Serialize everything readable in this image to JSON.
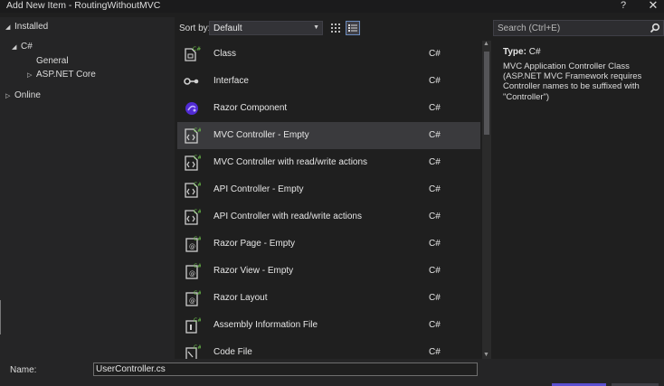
{
  "window": {
    "title": "Add New Item - RoutingWithoutMVC",
    "help": "?",
    "close": "✕"
  },
  "tree": {
    "installed": "Installed",
    "csharp": "C#",
    "general": "General",
    "aspnet": "ASP.NET Core",
    "online": "Online"
  },
  "toolbar": {
    "sort_label": "Sort by:",
    "sort_value": "Default"
  },
  "search": {
    "placeholder": "Search (Ctrl+E)"
  },
  "templates": [
    {
      "name": "Class",
      "lang": "C#",
      "icon": "class-icon"
    },
    {
      "name": "Interface",
      "lang": "C#",
      "icon": "interface-icon"
    },
    {
      "name": "Razor Component",
      "lang": "C#",
      "icon": "razor-component-icon"
    },
    {
      "name": "MVC Controller - Empty",
      "lang": "C#",
      "icon": "controller-icon"
    },
    {
      "name": "MVC Controller with read/write actions",
      "lang": "C#",
      "icon": "controller-icon"
    },
    {
      "name": "API Controller - Empty",
      "lang": "C#",
      "icon": "controller-icon"
    },
    {
      "name": "API Controller with read/write actions",
      "lang": "C#",
      "icon": "controller-icon"
    },
    {
      "name": "Razor Page - Empty",
      "lang": "C#",
      "icon": "razor-page-icon"
    },
    {
      "name": "Razor View - Empty",
      "lang": "C#",
      "icon": "razor-view-icon"
    },
    {
      "name": "Razor Layout",
      "lang": "C#",
      "icon": "razor-layout-icon"
    },
    {
      "name": "Assembly Information File",
      "lang": "C#",
      "icon": "assembly-info-icon"
    },
    {
      "name": "Code File",
      "lang": "C#",
      "icon": "code-file-icon"
    }
  ],
  "selected_index": 3,
  "details": {
    "type_label": "Type:",
    "type_value": "C#",
    "description": "MVC Application Controller Class (ASP.NET MVC Framework requires Controller names to be suffixed with \"Controller\")"
  },
  "name_field": {
    "label": "Name:",
    "value": "UserController.cs"
  },
  "colors": {
    "accent": "#5a4fcf",
    "selection": "#3a3a3d",
    "icon_green": "#6cc24a"
  }
}
